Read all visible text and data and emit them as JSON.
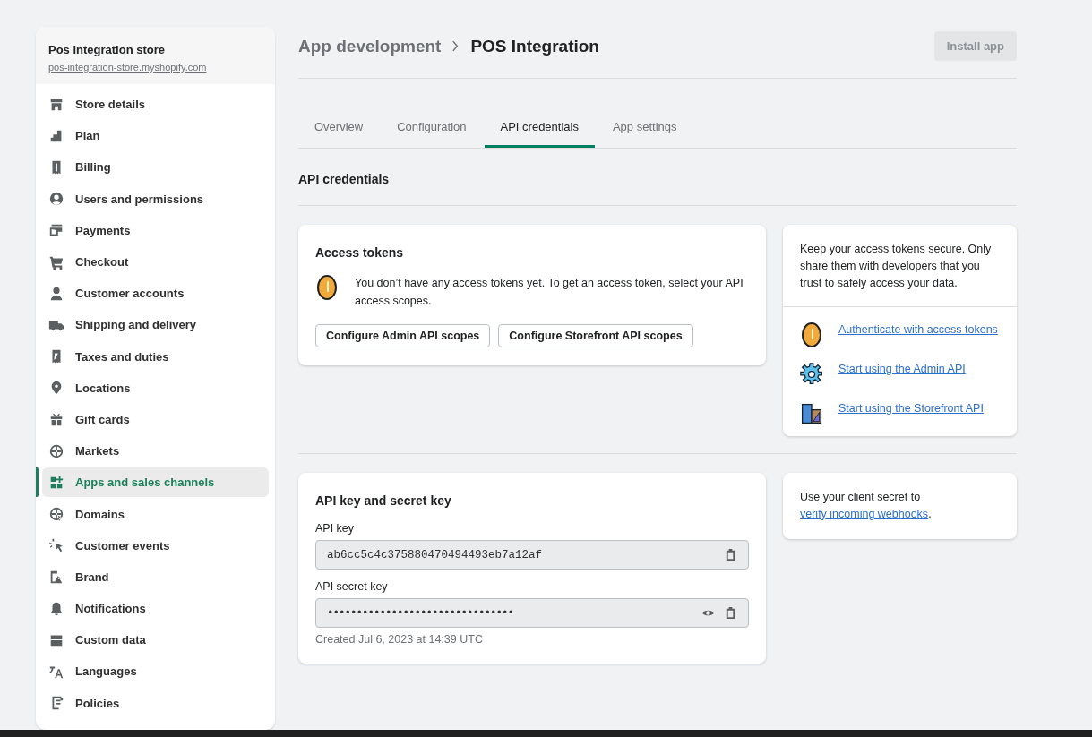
{
  "sidebar": {
    "store_name": "Pos integration store",
    "store_url": "pos-integration-store.myshopify.com",
    "items": [
      {
        "label": "Store details",
        "selected": false
      },
      {
        "label": "Plan",
        "selected": false
      },
      {
        "label": "Billing",
        "selected": false
      },
      {
        "label": "Users and permissions",
        "selected": false
      },
      {
        "label": "Payments",
        "selected": false
      },
      {
        "label": "Checkout",
        "selected": false
      },
      {
        "label": "Customer accounts",
        "selected": false
      },
      {
        "label": "Shipping and delivery",
        "selected": false
      },
      {
        "label": "Taxes and duties",
        "selected": false
      },
      {
        "label": "Locations",
        "selected": false
      },
      {
        "label": "Gift cards",
        "selected": false
      },
      {
        "label": "Markets",
        "selected": false
      },
      {
        "label": "Apps and sales channels",
        "selected": true
      },
      {
        "label": "Domains",
        "selected": false
      },
      {
        "label": "Customer events",
        "selected": false
      },
      {
        "label": "Brand",
        "selected": false
      },
      {
        "label": "Notifications",
        "selected": false
      },
      {
        "label": "Custom data",
        "selected": false
      },
      {
        "label": "Languages",
        "selected": false
      },
      {
        "label": "Policies",
        "selected": false
      }
    ]
  },
  "header": {
    "breadcrumb": "App development",
    "title": "POS Integration",
    "install_button": {
      "label": "Install app",
      "disabled": true
    }
  },
  "tabs": [
    {
      "label": "Overview",
      "selected": false
    },
    {
      "label": "Configuration",
      "selected": false
    },
    {
      "label": "API credentials",
      "selected": true
    },
    {
      "label": "App settings",
      "selected": false
    }
  ],
  "section_title": "API credentials",
  "access_tokens": {
    "title": "Access tokens",
    "message": "You don’t have any access tokens yet. To get an access token, select your API access scopes.",
    "buttons": [
      "Configure Admin API scopes",
      "Configure Storefront API scopes"
    ]
  },
  "tips": {
    "text": "Keep your access tokens secure. Only share them with developers that you trust to safely access your data.",
    "links": [
      "Authenticate with access tokens",
      "Start using the Admin API",
      "Start using the Storefront API"
    ]
  },
  "keys": {
    "title": "API key and secret key",
    "api_key": {
      "label": "API key",
      "value": "ab6cc5c4c375880470494493eb7a12af"
    },
    "secret_key": {
      "label": "API secret key",
      "value": "••••••••••••••••••••••••••••••••"
    },
    "created": "Created Jul 6, 2023 at 14:39 UTC"
  },
  "webhook_note": {
    "text_before": "Use your client secret to ",
    "link": "verify incoming webhooks",
    "text_after": "."
  }
}
